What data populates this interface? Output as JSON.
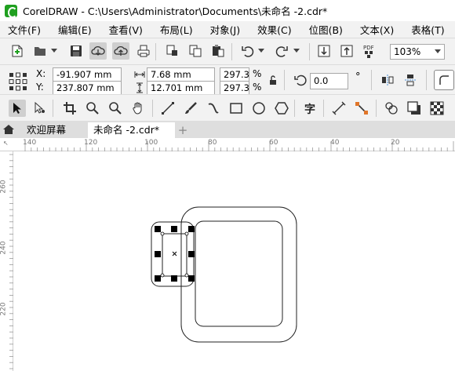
{
  "window": {
    "title": "CorelDRAW - C:\\Users\\Administrator\\Documents\\未命名 -2.cdr*"
  },
  "menu": [
    "文件(F)",
    "编辑(E)",
    "查看(V)",
    "布局(L)",
    "对象(J)",
    "效果(C)",
    "位图(B)",
    "文本(X)",
    "表格(T)"
  ],
  "toolbar": {
    "zoom": "103%"
  },
  "props": {
    "x_label": "X:",
    "x": "-91.907 mm",
    "y_label": "Y:",
    "y": "237.807 mm",
    "width": "7.68 mm",
    "height": "12.701 mm",
    "scale_x": "297.3",
    "scale_y": "297.3",
    "pct": "%",
    "rotation": "0.0",
    "degree": "°"
  },
  "tabs": {
    "welcome": "欢迎屏幕",
    "document": "未命名 -2.cdr*",
    "add": "+"
  },
  "ruler": {
    "h_ticks": [
      "140",
      "120",
      "100",
      "80",
      "60",
      "40",
      "20"
    ],
    "v_ticks": [
      "260",
      "240",
      "220"
    ]
  },
  "icons": {
    "new": "new-document-icon",
    "open": "open-folder-icon",
    "save": "save-icon",
    "cloud_down": "cloud-download-icon",
    "cloud_up": "cloud-upload-icon",
    "print": "print-icon",
    "undo": "undo-icon",
    "redo": "redo-icon",
    "import": "import-icon",
    "export": "export-icon",
    "pdf": "pdf-icon"
  },
  "colors": {
    "accent": "#20a020",
    "selection": "#000000",
    "chrome": "#f2f2f2"
  }
}
